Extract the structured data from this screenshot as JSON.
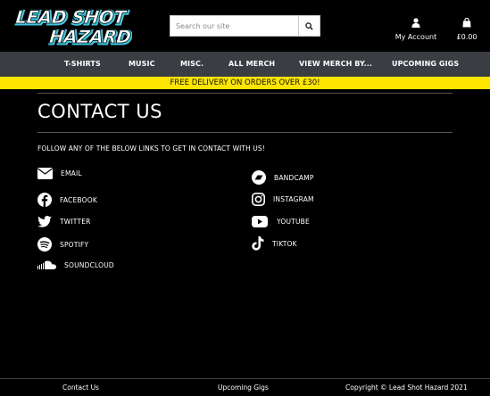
{
  "brand": {
    "logo_text_line1": "LEAD SHOT",
    "logo_text_line2": "HAZARD"
  },
  "header": {
    "search_placeholder": "Search our site",
    "account_label": "My Account",
    "cart_total": "£0.00"
  },
  "nav": {
    "items": [
      "T-SHIRTS",
      "MUSIC",
      "MISC.",
      "ALL MERCH",
      "VIEW MERCH BY...",
      "UPCOMING GIGS"
    ]
  },
  "banner": {
    "text": "FREE DELIVERY ON ORDERS OVER £30!"
  },
  "main": {
    "title": "CONTACT US",
    "intro": "FOLLOW ANY OF THE BELOW LINKS TO GET IN CONTACT WITH US!",
    "links": {
      "email": "EMAIL",
      "facebook": "FACEBOOK",
      "twitter": "TWITTER",
      "spotify": "SPOTIFY",
      "soundcloud": "SOUNDCLOUD",
      "bandcamp": "BANDCAMP",
      "instagram": "INSTAGRAM",
      "youtube": "YOUTUBE",
      "tiktok": "TIKTOK"
    }
  },
  "footer": {
    "contact": "Contact Us",
    "gigs": "Upcoming Gigs",
    "copyright": "Copyright © Lead Shot Hazard 2021"
  },
  "colors": {
    "banner": "#ffe600",
    "nav": "#3a3d42",
    "background": "#000000",
    "logo_accent": "#3ec6e0"
  }
}
